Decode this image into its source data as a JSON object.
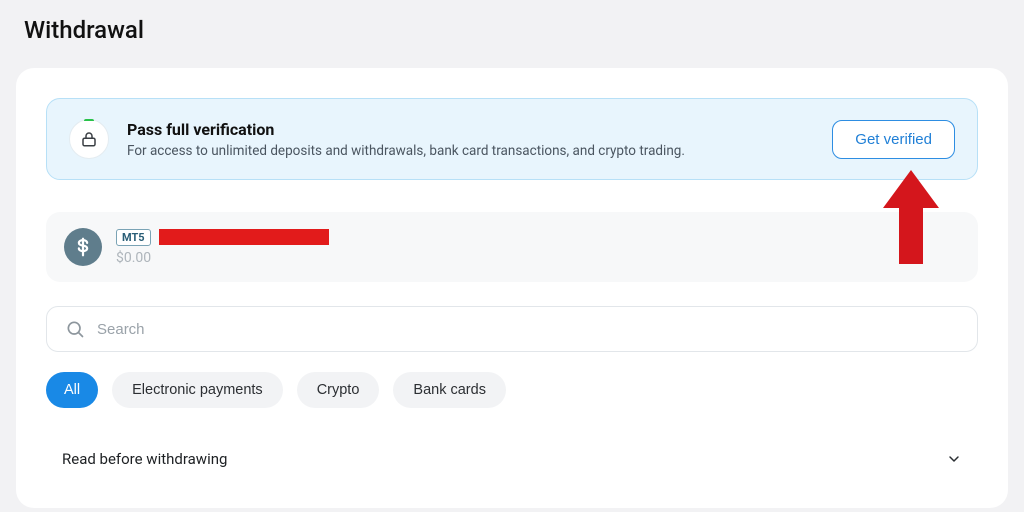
{
  "page": {
    "title": "Withdrawal"
  },
  "alert": {
    "title": "Pass full verification",
    "subtitle": "For access to unlimited deposits and withdrawals, bank card transactions, and crypto trading.",
    "cta": "Get verified"
  },
  "account": {
    "platform_badge": "MT5",
    "balance": "$0.00"
  },
  "search": {
    "placeholder": "Search"
  },
  "filters": {
    "all": "All",
    "electronic": "Electronic payments",
    "crypto": "Crypto",
    "bank": "Bank cards"
  },
  "accordion": {
    "label": "Read before withdrawing"
  }
}
